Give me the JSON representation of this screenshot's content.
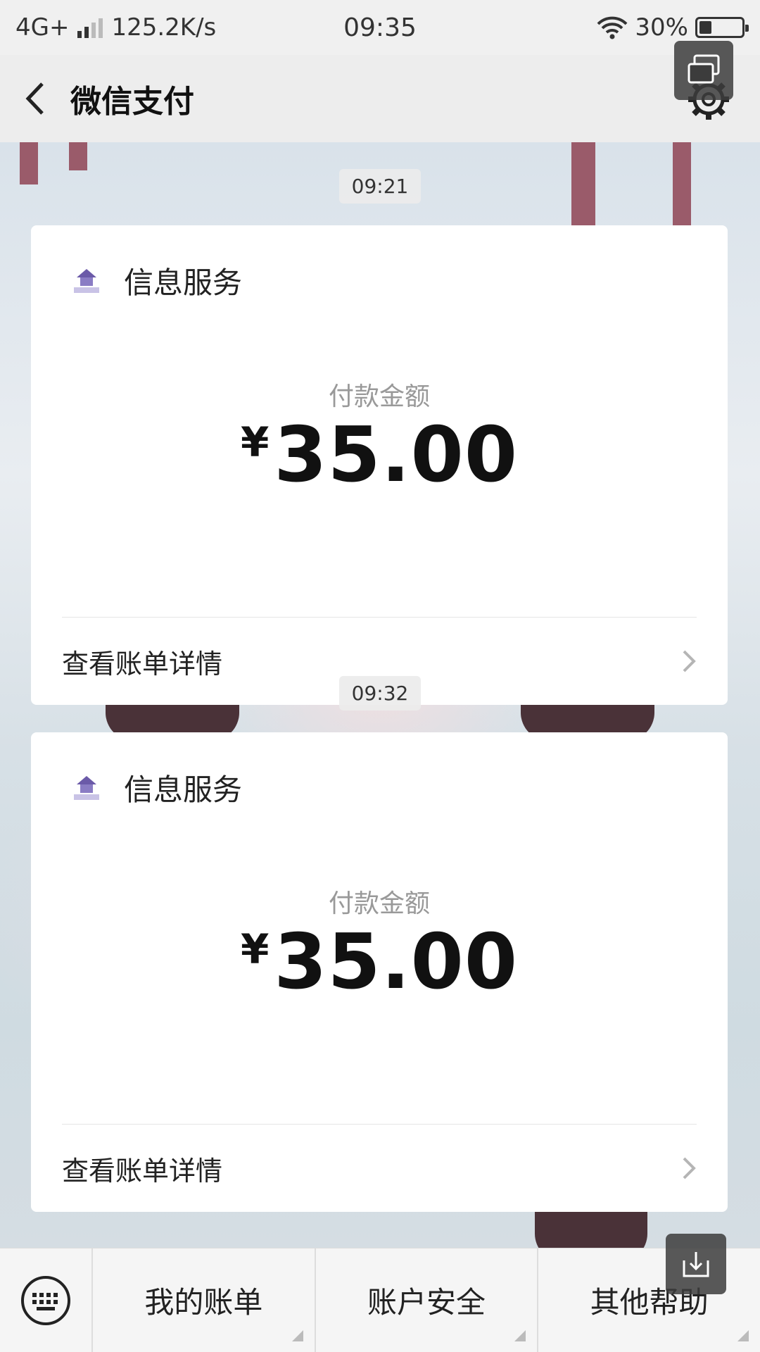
{
  "status_bar": {
    "network": "4G+",
    "speed": "125.2K/s",
    "time": "09:35",
    "battery": "30%",
    "battery_level": 0.3
  },
  "nav": {
    "title": "微信支付"
  },
  "messages": [
    {
      "timestamp": "09:21",
      "merchant": "信息服务",
      "amount_label": "付款金额",
      "currency": "¥",
      "amount": "35.00",
      "detail_link": "查看账单详情"
    },
    {
      "timestamp": "09:32",
      "merchant": "信息服务",
      "amount_label": "付款金额",
      "currency": "¥",
      "amount": "35.00",
      "detail_link": "查看账单详情"
    }
  ],
  "bottom_menu": {
    "items": [
      {
        "label": "我的账单"
      },
      {
        "label": "账户安全"
      },
      {
        "label": "其他帮助"
      }
    ]
  },
  "colors": {
    "nav_bg": "#ededed",
    "card_bg": "#ffffff",
    "amount_text": "#111111",
    "label_text": "#999999"
  },
  "icons": [
    "back-arrow-icon",
    "settings-icon",
    "floating-window-icon",
    "keyboard-icon",
    "export-icon",
    "chevron-right-icon",
    "merchant-logo-icon",
    "wifi-icon",
    "signal-icon",
    "battery-icon"
  ]
}
